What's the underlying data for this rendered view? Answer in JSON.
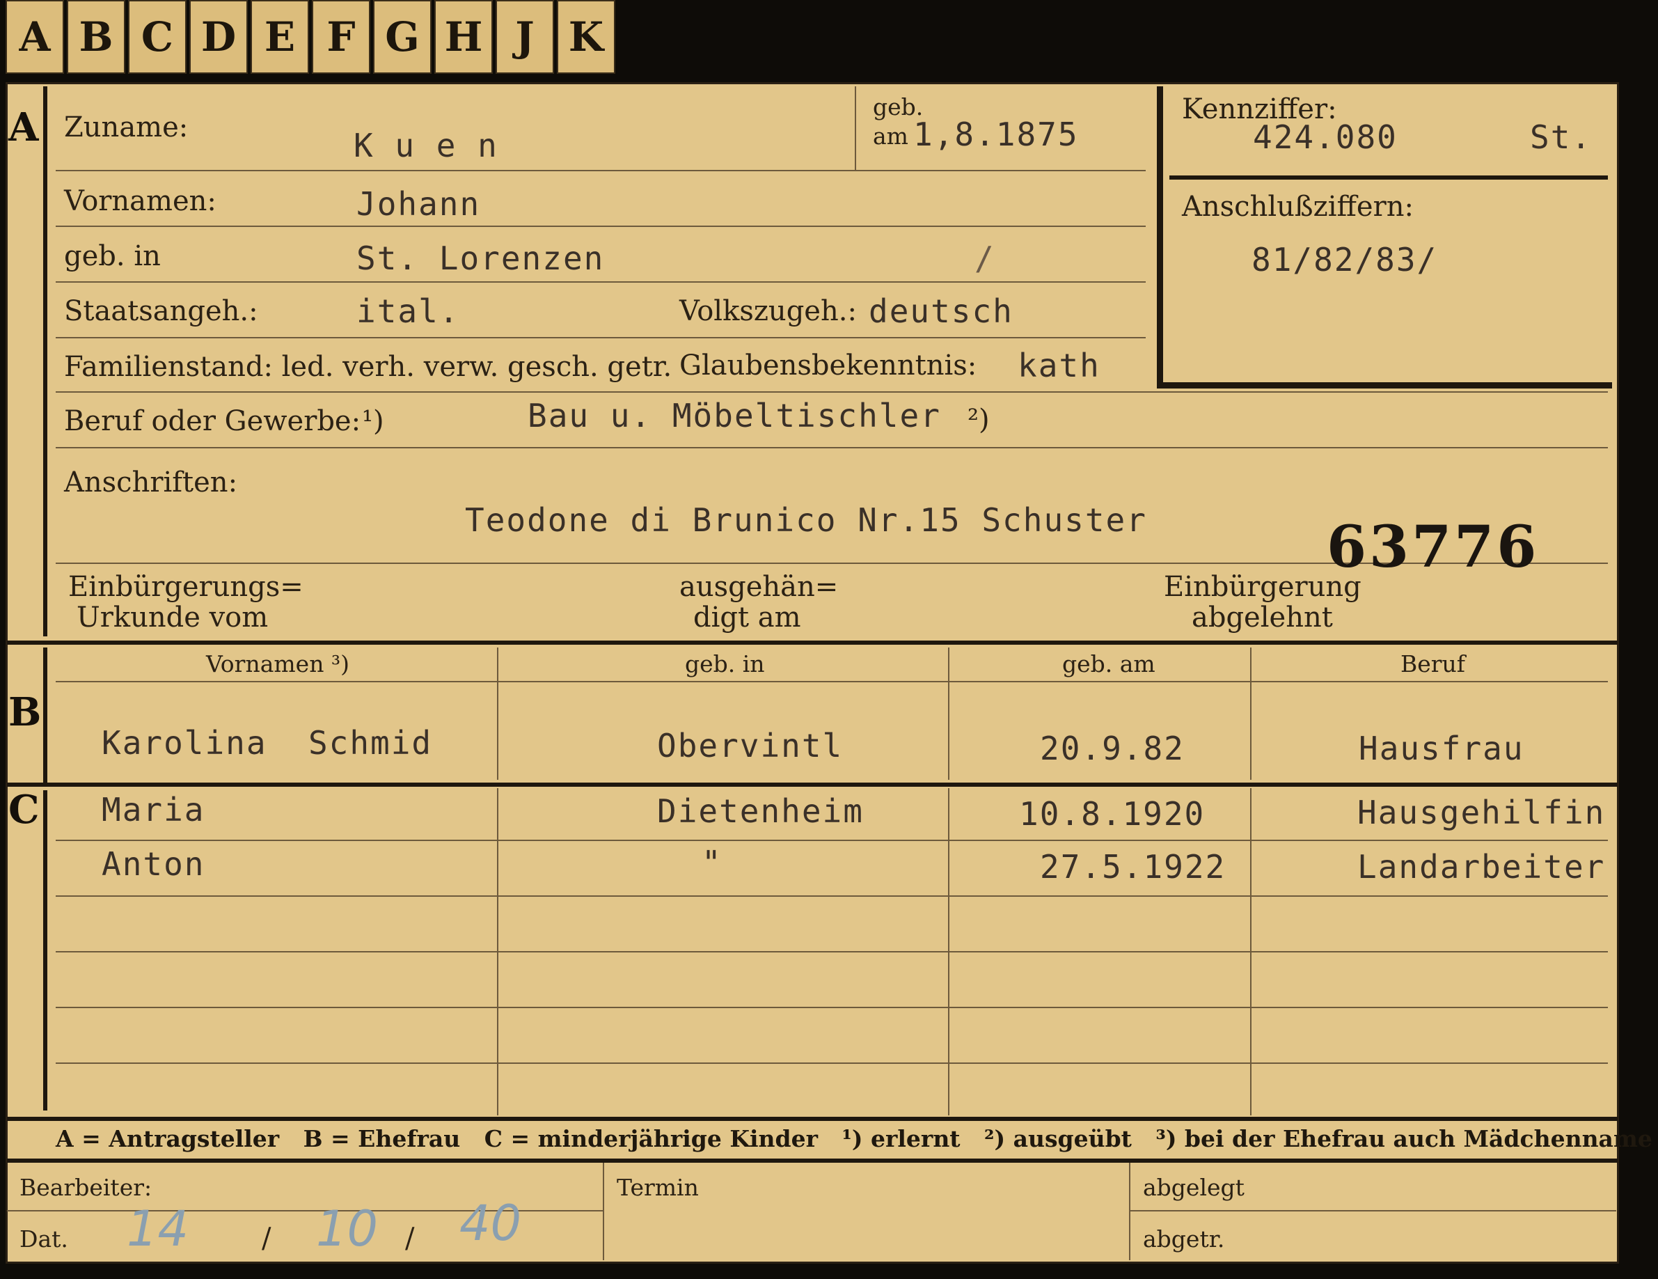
{
  "tabs": [
    "A",
    "B",
    "C",
    "D",
    "E",
    "F",
    "G",
    "H",
    "J",
    "K"
  ],
  "sections": {
    "a": "A",
    "b": "B",
    "c": "C"
  },
  "applicant": {
    "surname_label": "Zuname:",
    "surname": "K u e n",
    "born_on_label_1": "geb.",
    "born_on_label_2": "am",
    "born_on": "1,8.1875",
    "given_names_label": "Vornamen:",
    "given_names": "Johann",
    "born_in_label": "geb. in",
    "born_in": "St. Lorenzen",
    "born_in_mark": "/",
    "citizenship_label": "Staatsangeh.:",
    "citizenship": "ital.",
    "ethnicity_label": "Volkszugeh.:",
    "ethnicity": "deutsch",
    "marital_label": "Familienstand: led. verh. verw. gesch. getr.",
    "religion_label": "Glaubensbekenntnis:",
    "religion": "kath",
    "occupation_label": "Beruf oder Gewerbe:",
    "occupation_note1": "¹)",
    "occupation": "Bau u. Möbeltischler",
    "occupation_note2": "²)",
    "address_label": "Anschriften:",
    "address": "Teodone di Brunico Nr.15 Schuster",
    "stamp_number": "63776",
    "naturalization_label_1": "Einbürgerungs=",
    "naturalization_label_2": "Urkunde vom",
    "handed_label_1": "ausgehän=",
    "handed_label_2": "digt am",
    "rejected_label_1": "Einbürgerung",
    "rejected_label_2": "abgelehnt"
  },
  "reference": {
    "code_label": "Kennziffer:",
    "code": "424.080",
    "code_suffix": "St.",
    "linked_label": "Anschlußziffern:",
    "linked": "81/82/83/"
  },
  "family_table": {
    "headers": [
      "Vornamen ³)",
      "geb. in",
      "geb. am",
      "Beruf"
    ],
    "spouse": [
      "Karolina  Schmid",
      "Obervintl",
      "20.9.82",
      "Hausfrau"
    ],
    "children": [
      [
        "Maria",
        "Dietenheim",
        "10.8.1920",
        "Hausgehilfin"
      ],
      [
        "Anton",
        "\"",
        "27.5.1922",
        "Landarbeiter"
      ]
    ]
  },
  "legend": "A = Antragsteller   B = Ehefrau   C = minderjährige Kinder   ¹) erlernt   ²) ausgeübt   ³) bei der Ehefrau auch Mädchenname",
  "footer": {
    "clerk_label": "Bearbeiter:",
    "date_label": "Dat.",
    "date_day": "14",
    "date_sep": "/",
    "date_month": "10",
    "date_year": "40",
    "appointment_label": "Termin",
    "filed_label": "abgelegt",
    "removed_label": "abgetr."
  }
}
